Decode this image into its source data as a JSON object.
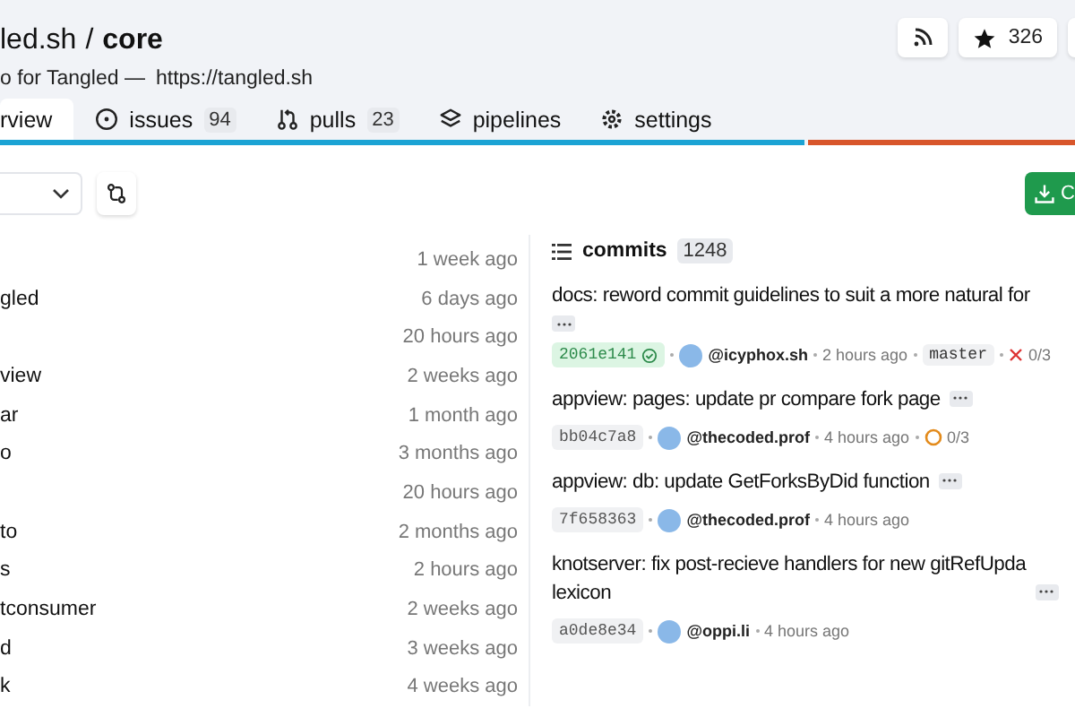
{
  "repo": {
    "owner": "led.sh",
    "separator": "/",
    "name": "core",
    "description": "o for Tangled —",
    "link": "https://tangled.sh"
  },
  "actions": {
    "star_count": "326"
  },
  "tabs": [
    {
      "label": "rview",
      "selected": true
    },
    {
      "label": "issues",
      "count": "94",
      "selected": false
    },
    {
      "label": "pulls",
      "count": "23",
      "selected": false
    },
    {
      "label": "pipelines",
      "selected": false
    },
    {
      "label": "settings",
      "selected": false
    }
  ],
  "language_bar": [
    {
      "color": "#1ba3d4",
      "level": 0.75
    },
    {
      "color": "#d8562b",
      "level": 0.25
    }
  ],
  "clone_button": {
    "label": "C"
  },
  "files": [
    {
      "time": "1 week ago"
    },
    {
      "name": "gled",
      "time": "6 days ago"
    },
    {
      "time": "20 hours ago"
    },
    {
      "name": "view",
      "time": "2 weeks ago"
    },
    {
      "name": "ar",
      "time": "1 month ago"
    },
    {
      "name": "o",
      "time": "3 months ago"
    },
    {
      "time": "20 hours ago"
    },
    {
      "name": "to",
      "time": "2 months ago"
    },
    {
      "name": "s",
      "time": "2 hours ago"
    },
    {
      "name": "tconsumer",
      "time": "2 weeks ago"
    },
    {
      "name": "d",
      "time": "3 weeks ago"
    },
    {
      "name": "k",
      "time": "4 weeks ago"
    }
  ],
  "commits": {
    "title": "commits",
    "count": "1248",
    "items": [
      {
        "lines": [
          "docs: reword commit guidelines to suit a more natural for"
        ],
        "ellipsis_below": true,
        "sha": "2061e141",
        "verified": true,
        "author": "@icyphox.sh",
        "time": "2 hours ago",
        "branch": "master",
        "ci": {
          "kind": "failed",
          "label": "0/3"
        }
      },
      {
        "lines": [
          "appview: pages: update pr compare fork page"
        ],
        "ellipsis_below": false,
        "sha": "bb04c7a8",
        "verified": false,
        "author": "@thecoded.prof",
        "time": "4 hours ago",
        "ci": {
          "kind": "pending",
          "label": "0/3"
        }
      },
      {
        "lines": [
          "appview: db: update GetForksByDid function"
        ],
        "ellipsis_below": false,
        "sha": "7f658363",
        "verified": false,
        "author": "@thecoded.prof",
        "time": "4 hours ago"
      },
      {
        "lines": [
          "knotserver: fix post-recieve handlers for new gitRefUpda",
          "lexicon"
        ],
        "ellipsis_below": false,
        "sha": "a0de8e34",
        "verified": false,
        "author": "@oppi.li",
        "time": "4 hours ago"
      }
    ]
  }
}
